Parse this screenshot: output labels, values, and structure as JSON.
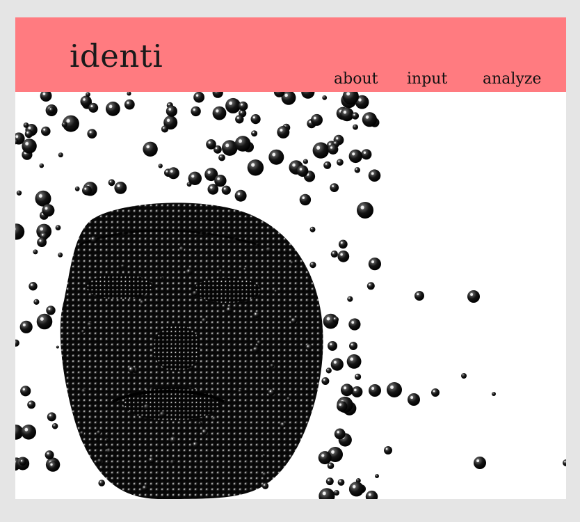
{
  "header": {
    "logo": "identi",
    "background": "#ff7b80",
    "nav": {
      "about": "about",
      "input": "input",
      "analyze": "analyze"
    }
  },
  "hero": {
    "image": "sphere-face-illustration"
  },
  "colors": {
    "page_background": "#e5e5e5",
    "content_background": "#ffffff",
    "sphere": "#111111"
  }
}
